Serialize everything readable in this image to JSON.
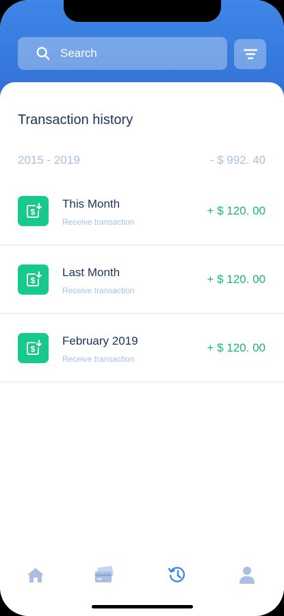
{
  "search": {
    "placeholder": "Search"
  },
  "header": {
    "title": "Transaction history"
  },
  "summary": {
    "range": "2015 - 2019",
    "total": "- $ 992. 40"
  },
  "transactions": [
    {
      "title": "This Month",
      "subtitle": "Receive transaction",
      "amount": "+ $ 120. 00"
    },
    {
      "title": "Last Month",
      "subtitle": "Receive transaction",
      "amount": "+ $ 120. 00"
    },
    {
      "title": "February 2019",
      "subtitle": "Receive transaction",
      "amount": "+ $ 120. 00"
    }
  ],
  "tabs": [
    {
      "icon": "home-icon",
      "active": false
    },
    {
      "icon": "credit-card-icon",
      "active": false
    },
    {
      "icon": "history-icon",
      "active": true
    },
    {
      "icon": "profile-icon",
      "active": false
    }
  ],
  "colors": {
    "header": "#3f86e8",
    "accent_green": "#18c98e",
    "amount_green": "#1ab57f",
    "muted_blue": "#a9c0e2",
    "text_dark": "#1d3461",
    "tab_inactive": "#a9c0e2",
    "tab_active": "#3f86e8"
  }
}
